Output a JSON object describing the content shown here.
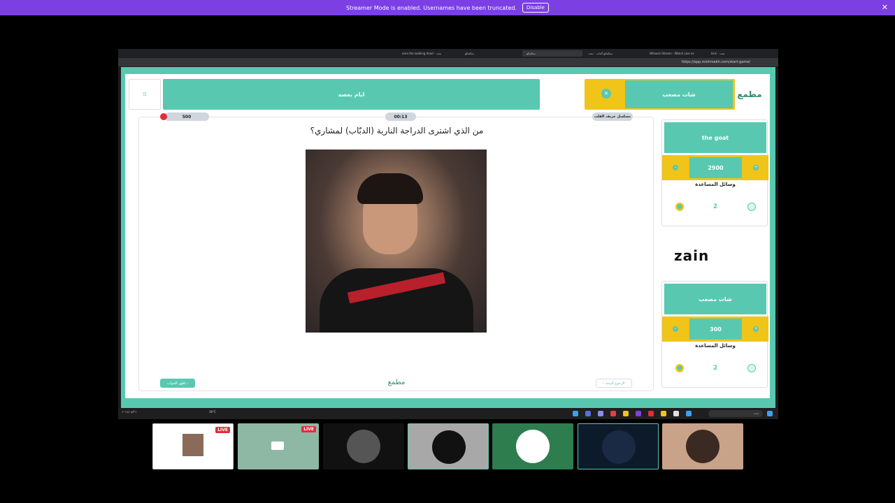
{
  "banner": {
    "text": "Streamer Mode is enabled. Usernames have been truncated.",
    "disable_label": "Disable",
    "close_glyph": "✕"
  },
  "browser": {
    "tabs": [
      "aren the walking dead - بحث",
      "سالمالع",
      "سالمالع",
      "سالمالع ألعاب - بحث",
      "Whoosh Stream - Watch Live on",
      "kick - بحث"
    ],
    "url": "https://app.mishmekh.com/start-game/"
  },
  "game": {
    "team_left": {
      "name": "شات مصعب",
      "logo_text": "مطمع",
      "badge": "✕"
    },
    "team_right": {
      "name": "ايام بعصه"
    },
    "category": "مسلسل خريف القلب",
    "timer": "00:13",
    "points": "500",
    "question": "من الذي اشترى الدراجة النارية (الدبّاب) لمشاري؟",
    "show_answer_label": "اظهر الجواب ›",
    "back_label": "‹ الرجوع للوحة",
    "footer_logo": "مطمع",
    "corner_label": "ⵗⵗ"
  },
  "sidebar": {
    "team1": {
      "name": "the goat",
      "score": "2900",
      "helps_label": "وسائل المساعدة",
      "minus": "-",
      "plus": "+"
    },
    "sponsor": "zain",
    "team2": {
      "name": "شات مصعب",
      "score": "300",
      "helps_label": "وسائل المساعدة",
      "minus": "-",
      "plus": "+"
    }
  },
  "taskbar": {
    "date": "٢٠٢٤/٠٥/٢٦",
    "weather": "36°C",
    "search_placeholder": "بحث"
  },
  "tiles": {
    "live_label": "LIVE",
    "live_label_2": "LIVE"
  },
  "colors": {
    "accent": "#58c9b0",
    "yellow": "#f0c419",
    "banner": "#7b3fe4",
    "live": "#e52b3a"
  }
}
